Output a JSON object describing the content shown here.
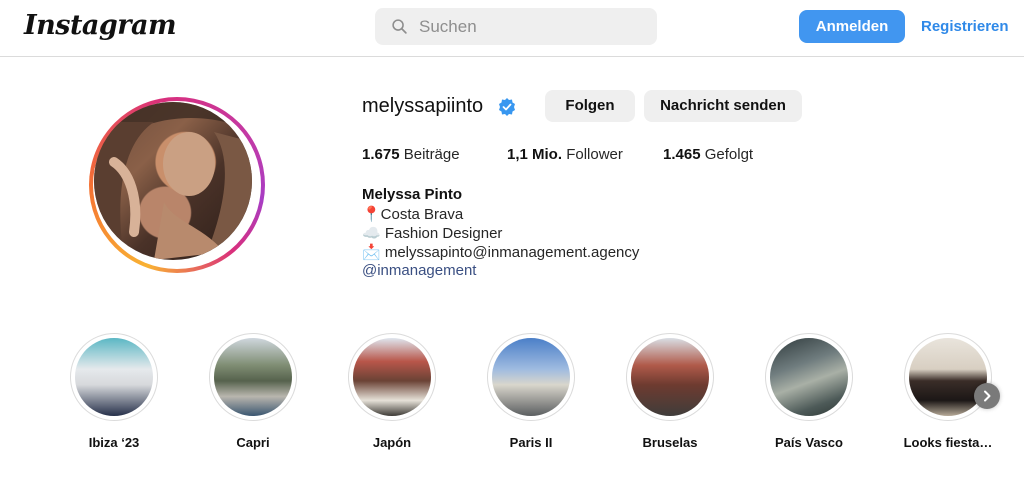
{
  "header": {
    "logo": "Instagram",
    "search_placeholder": "Suchen",
    "login_label": "Anmelden",
    "register_label": "Registrieren"
  },
  "profile": {
    "username": "melyssapiinto",
    "follow_label": "Folgen",
    "message_label": "Nachricht senden",
    "stats": {
      "posts_value": "1.675",
      "posts_label": "Beiträge",
      "followers_value": "1,1 Mio.",
      "followers_label": "Follower",
      "following_value": "1.465",
      "following_label": "Gefolgt"
    },
    "bio": {
      "name": "Melyssa Pinto",
      "line1": "📍Costa Brava",
      "line2": "☁️ Fashion Designer",
      "line3": "📩 melyssapinto@inmanagement.agency",
      "link": "@inmanagement"
    }
  },
  "highlights": [
    {
      "label": "Ibiza ‘23"
    },
    {
      "label": "Capri"
    },
    {
      "label": "Japón"
    },
    {
      "label": "Paris II"
    },
    {
      "label": "Bruselas"
    },
    {
      "label": "País Vasco"
    },
    {
      "label": "Looks fiesta…"
    }
  ],
  "icons": {
    "search": "search-icon",
    "verified": "verified-badge-icon",
    "next": "chevron-right-icon"
  },
  "colors": {
    "primary_button": "#4196f0",
    "link": "#2f89e8",
    "bio_link": "#3a4f82",
    "secondary_button": "#efefef"
  }
}
